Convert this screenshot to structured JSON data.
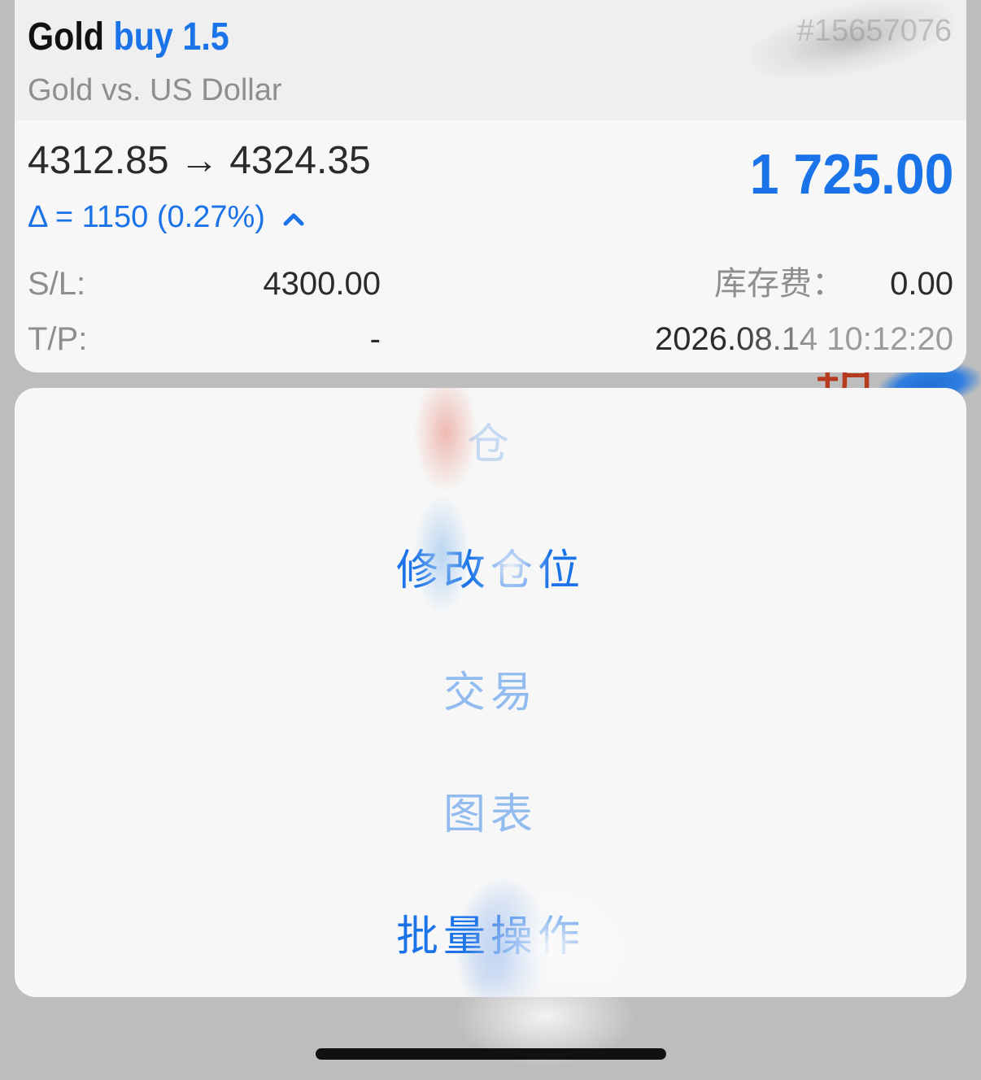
{
  "position": {
    "symbol": "Gold",
    "side": "buy",
    "volume": "1.5",
    "ticket": "#15657076",
    "description": "Gold vs. US Dollar",
    "price_open": "4312.85",
    "arrow": "→",
    "price_current": "4324.35",
    "delta": "Δ = 1150 (0.27%)",
    "delta_direction_icon": "chevron-up-icon",
    "profit": "1 725.00",
    "sl_label": "S/L:",
    "sl_value": "4300.00",
    "tp_label": "T/P:",
    "tp_value": "-",
    "swap_label": "库存费：",
    "swap_value": "0.00",
    "open_time": "2026.08.14 10:12:20"
  },
  "background": {
    "char": "玥"
  },
  "action_sheet": {
    "items": [
      {
        "label": "仓"
      },
      {
        "label": "修改仓位"
      },
      {
        "label": "交易"
      },
      {
        "label": "图表"
      },
      {
        "label": "批量操作"
      }
    ]
  },
  "colors": {
    "accent": "#1a73e8",
    "background_dim": "#bdbdbd",
    "card": "#f7f7f7",
    "secondary_text": "#8e8e8e"
  }
}
